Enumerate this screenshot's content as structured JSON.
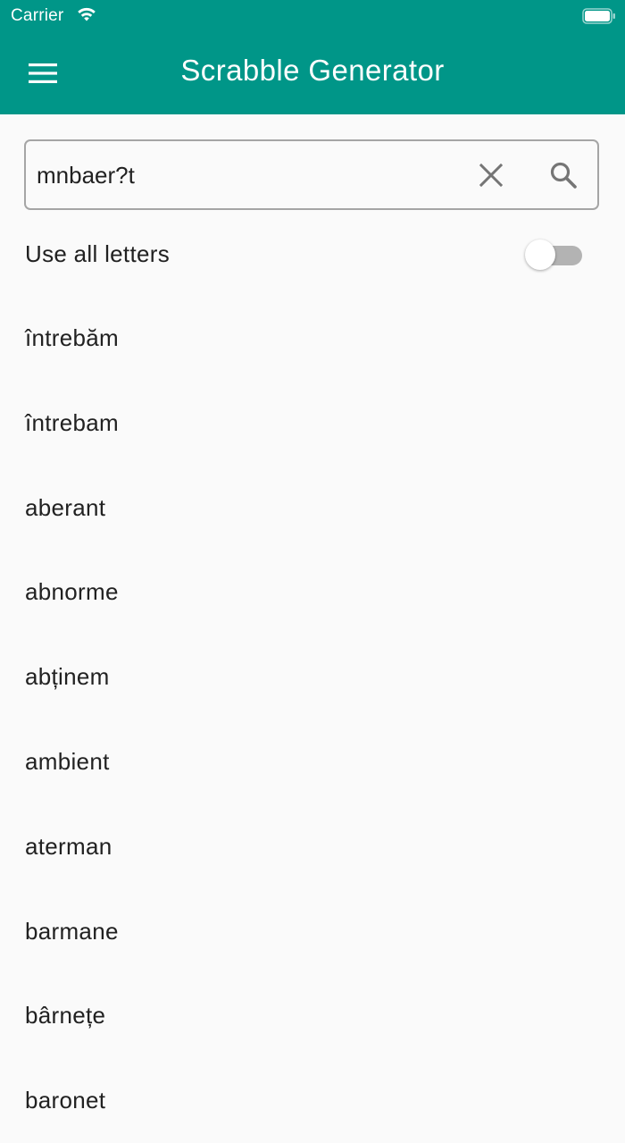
{
  "status_bar": {
    "carrier": "Carrier"
  },
  "app_bar": {
    "title": "Scrabble Generator",
    "background_color": "#009688"
  },
  "search": {
    "value": "mnbaer?t",
    "placeholder": ""
  },
  "options": {
    "use_all_letters_label": "Use all letters",
    "use_all_letters_enabled": false
  },
  "results": [
    "întrebăm",
    "întrebam",
    "aberant",
    "abnorme",
    "abținem",
    "ambient",
    "aterman",
    "barmane",
    "bârnețe",
    "baronet"
  ]
}
